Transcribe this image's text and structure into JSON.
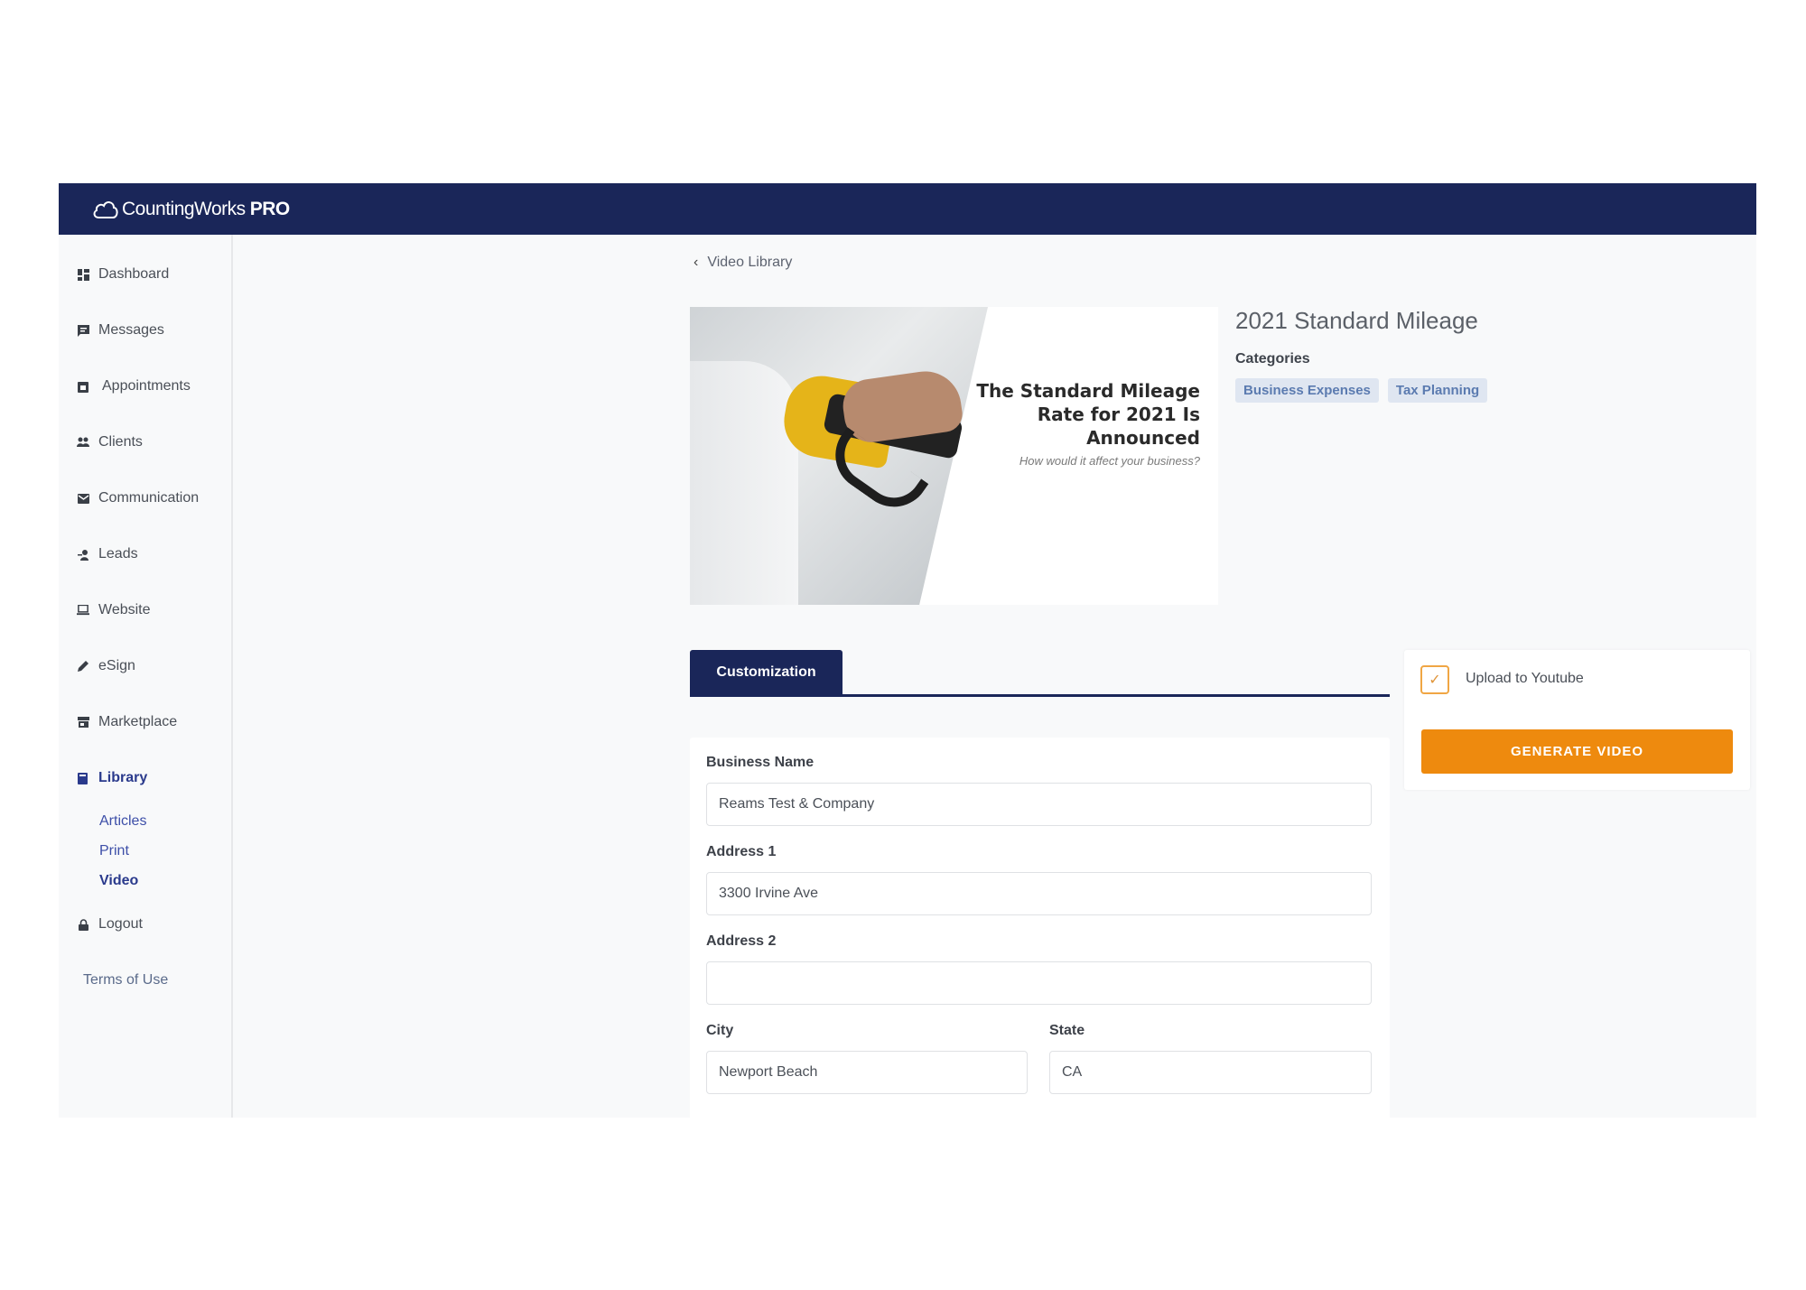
{
  "app": {
    "brand": "CountingWorks",
    "brand_suffix": "PRO"
  },
  "sidebar": {
    "items": [
      {
        "label": "Dashboard",
        "icon": "dashboard-icon"
      },
      {
        "label": "Messages",
        "icon": "message-icon"
      },
      {
        "label": "Appointments",
        "icon": "calendar-icon"
      },
      {
        "label": "Clients",
        "icon": "users-icon"
      },
      {
        "label": "Communication",
        "icon": "mail-icon"
      },
      {
        "label": "Leads",
        "icon": "leads-icon"
      },
      {
        "label": "Website",
        "icon": "laptop-icon"
      },
      {
        "label": "eSign",
        "icon": "pen-icon"
      },
      {
        "label": "Marketplace",
        "icon": "store-icon"
      },
      {
        "label": "Library",
        "icon": "book-icon"
      },
      {
        "label": "Logout",
        "icon": "lock-icon"
      }
    ],
    "library_sub": [
      "Articles",
      "Print",
      "Video"
    ],
    "active_item": "Library",
    "active_sub": "Video",
    "terms": "Terms of Use"
  },
  "breadcrumb": {
    "back_label": "Video Library"
  },
  "video": {
    "title": "2021 Standard Mileage",
    "thumbnail_headline": "The Standard Mileage Rate for 2021 Is Announced",
    "thumbnail_subtitle": "How would it affect your business?",
    "categories_label": "Categories",
    "categories": [
      "Business Expenses",
      "Tax Planning"
    ]
  },
  "tabs": [
    {
      "label": "Customization",
      "active": true
    }
  ],
  "form": {
    "business_name": {
      "label": "Business Name",
      "value": "Reams Test & Company"
    },
    "address1": {
      "label": "Address 1",
      "value": "3300 Irvine Ave"
    },
    "address2": {
      "label": "Address 2",
      "value": ""
    },
    "city": {
      "label": "City",
      "value": "Newport Beach"
    },
    "state": {
      "label": "State",
      "value": "CA"
    }
  },
  "actions": {
    "upload_label": "Upload to Youtube",
    "upload_checked": true,
    "generate_label": "GENERATE VIDEO"
  },
  "colors": {
    "topbar": "#1a2659",
    "accent": "#ee8a0e",
    "tag_bg": "#dfe6f1",
    "tag_text": "#5b7bb0"
  }
}
